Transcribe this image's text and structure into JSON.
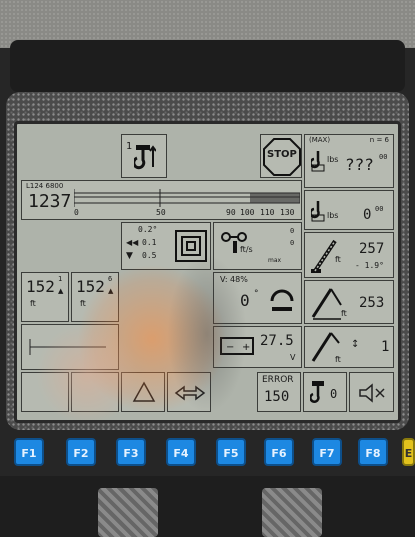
{
  "hook_indicator": {
    "left": "1",
    "right": "1"
  },
  "stop_label": "STOP",
  "max_label": "(MAX)",
  "n_label": "n = 6",
  "max_load": {
    "unit": "lbs",
    "value": "???",
    "sub": "00"
  },
  "length_scale": {
    "code": "L124 6800",
    "value": "1237",
    "ticks": [
      "0",
      "50",
      "90",
      "100",
      "110",
      "130"
    ]
  },
  "current_load": {
    "unit": "lbs",
    "value": "0",
    "sub": "00"
  },
  "tilt": {
    "top": "0.2°",
    "mid": "0.1",
    "bottom": "0.5"
  },
  "wind": {
    "unit": "ft/s",
    "sub": "max",
    "value": "0",
    "value2": "0"
  },
  "boom_angle": {
    "value": "257",
    "unit": "ft",
    "sub": "- 1.9°"
  },
  "left_length": {
    "value": "152",
    "sup": "1",
    "unit": "ft"
  },
  "right_length": {
    "value": "152",
    "sup": "6",
    "unit": "ft"
  },
  "slew": {
    "label": "V: 48%",
    "value": "0",
    "unit": "°"
  },
  "radius": {
    "value": "253",
    "unit": "ft"
  },
  "battery": {
    "value": "27.5",
    "unit": "V"
  },
  "extension": {
    "value": "1",
    "unit": "ft"
  },
  "error": {
    "label": "ERROR",
    "code": "150"
  },
  "hook_count": {
    "value": "0"
  },
  "fkeys": [
    "F1",
    "F2",
    "F3",
    "F4",
    "F5",
    "F6",
    "F7",
    "F8",
    "E"
  ]
}
